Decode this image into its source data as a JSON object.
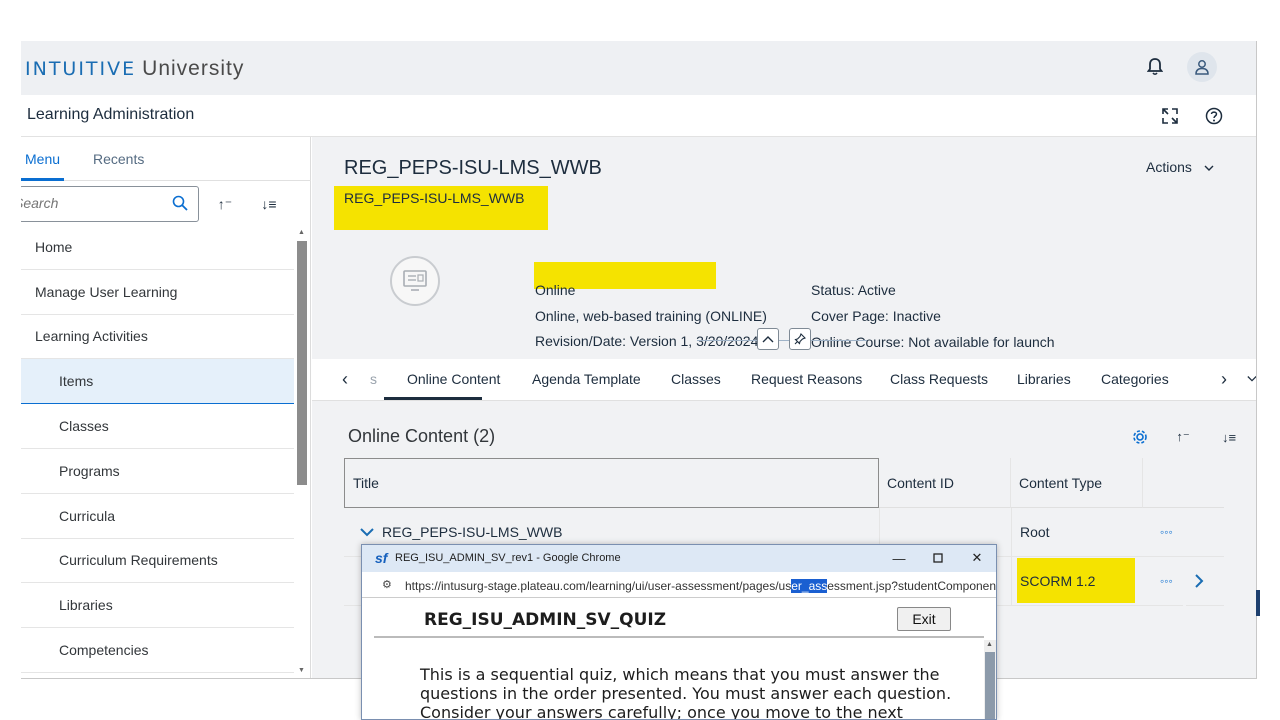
{
  "shell": {
    "brand": "INTUITIVE",
    "product": "University"
  },
  "header": {
    "title": "Learning Administration"
  },
  "sidebar": {
    "tabs": [
      "Menu",
      "Recents"
    ],
    "search_placeholder": "Search",
    "items": [
      {
        "label": "Home"
      },
      {
        "label": "Manage User Learning"
      },
      {
        "label": "Learning Activities"
      },
      {
        "label": "Items"
      },
      {
        "label": "Classes"
      },
      {
        "label": "Programs"
      },
      {
        "label": "Curricula"
      },
      {
        "label": "Curriculum Requirements"
      },
      {
        "label": "Libraries"
      },
      {
        "label": "Competencies"
      }
    ]
  },
  "object": {
    "title": "REG_PEPS-ISU-LMS_WWB",
    "subtitle": "REG_PEPS-ISU-LMS_WWB",
    "actions": "Actions",
    "delivery": "Online",
    "type": "Online, web-based training (ONLINE)",
    "revision": "Revision/Date: Version 1, 3/20/2024",
    "status": "Status: Active",
    "cover_page": "Cover Page: Inactive",
    "online_course": "Online Course: Not available for launch"
  },
  "tabs": {
    "truncated": "s",
    "items": [
      "Online Content",
      "Agenda Template",
      "Classes",
      "Request Reasons",
      "Class Requests",
      "Libraries",
      "Categories"
    ],
    "active": "Online Content"
  },
  "content": {
    "title": "Online Content (2)",
    "columns": [
      "Title",
      "Content ID",
      "Content Type"
    ],
    "rows": [
      {
        "title": "REG_PEPS-ISU-LMS_WWB",
        "content_id": "",
        "content_type": "Root"
      },
      {
        "title": "",
        "content_id": "",
        "content_type": "SCORM 1.2"
      }
    ],
    "more": "◦◦◦"
  },
  "popup": {
    "window_title": "REG_ISU_ADMIN_SV_rev1 - Google Chrome",
    "url_before": "https://intusurg-stage.plateau.com/learning/ui/user-assessment/pages/us",
    "url_selected": "er_ass",
    "url_after": "essment.jsp?studentComponen",
    "quiz_title": "REG_ISU_ADMIN_SV_QUIZ",
    "exit": "Exit",
    "body": "This is a sequential quiz, which means that you must answer the questions in the order presented. You must answer each question. Consider your answers carefully; once you move to the next"
  },
  "colors": {
    "accent": "#0a6ed1",
    "highlight": "#f5e300"
  }
}
